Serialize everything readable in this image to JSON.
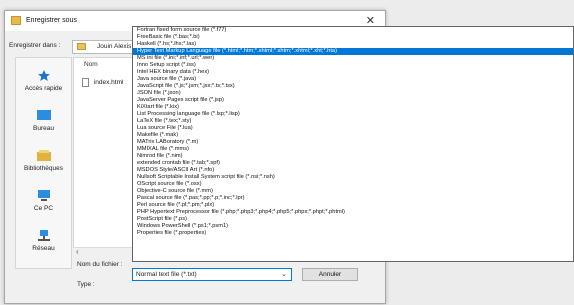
{
  "window": {
    "title": "Enregistrer sous",
    "close_glyph": "✕"
  },
  "save_in": {
    "label": "Enregistrer dans :",
    "folder": "Jouin Alexis"
  },
  "places": [
    {
      "label": "Accès rapide",
      "icon": "star-icon",
      "color": "#1e6fd0"
    },
    {
      "label": "Bureau",
      "icon": "desktop-icon",
      "color": "#2a8de0"
    },
    {
      "label": "Bibliothèques",
      "icon": "libraries-icon",
      "color": "#e3b23c"
    },
    {
      "label": "Ce PC",
      "icon": "computer-icon",
      "color": "#2a8de0"
    },
    {
      "label": "Réseau",
      "icon": "network-icon",
      "color": "#2a8de0"
    }
  ],
  "file_list": {
    "column_header": "Nom",
    "files": [
      {
        "name": "index.html"
      }
    ],
    "scroll_left_glyph": "‹"
  },
  "filetype_options": [
    "Fortran fixed form source file (*.f77)",
    "FreeBasic file (*.bas;*.bi)",
    "Haskell (*.hs;*.lhs;*.las)",
    "Hyper Text Markup Language file (*.html;*.htm;*.shtml;*.shtm;*.xhtml;*.xht;*.hta)",
    "MS ini file (*.ini;*.inf;*.url;*.wer)",
    "Inno Setup script (*.iss)",
    "Intel HEX binary data (*.hex)",
    "Java source file (*.java)",
    "JavaScript file (*.js;*.jsm;*.jsx;*.ts;*.tsx)",
    "JSON file (*.json)",
    "JavaServer Pages script file (*.jsp)",
    "KiXtart file (*.kix)",
    "List Processing language file (*.lsp;*.lisp)",
    "LaTeX file (*.tex;*.sty)",
    "Lua source File (*.lua)",
    "Makefile (*.mak)",
    "MATrix LABoratory (*.m)",
    "MMIXAL file (*.mms)",
    "Nimrod file (*.nim)",
    "extended crontab file (*.tab;*.spf)",
    "MSDOS Style/ASCII Art (*.nfo)",
    "Nullsoft Scriptable Install System script file (*.nsi;*.nsh)",
    "OScript source file (*.osx)",
    "Objective-C source file (*.mm)",
    "Pascal source file (*.pas;*.pp;*.p;*.inc;*.lpr)",
    "Perl source file (*.pl;*.pm;*.plx)",
    "PHP Hypertext Preprocessor file (*.php;*.php3;*.php4;*.php5;*.phps;*.phpt;*.phtml)",
    "PostScript file (*.ps)",
    "Windows PowerShell (*.ps1;*.psm1)",
    "Properties file (*.properties)"
  ],
  "selected_option_index": 3,
  "selection_color": "#0078d7",
  "filename": {
    "label": "Nom du fichier :",
    "value": ""
  },
  "filetype": {
    "label": "Type :",
    "value": "Normal text file (*.txt)",
    "chevron": "⌄"
  },
  "buttons": {
    "cancel": "Annuler"
  }
}
